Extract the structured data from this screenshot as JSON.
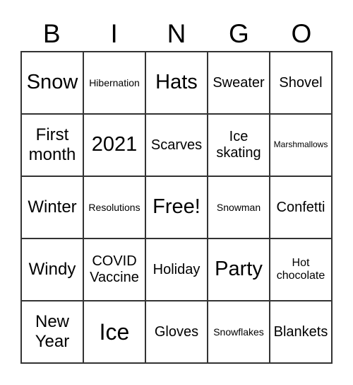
{
  "header": [
    "B",
    "I",
    "N",
    "G",
    "O"
  ],
  "cells": [
    [
      "Snow",
      "Hibernation",
      "Hats",
      "Sweater",
      "Shovel"
    ],
    [
      "First month",
      "2021",
      "Scarves",
      "Ice skating",
      "Marshmallows"
    ],
    [
      "Winter",
      "Resolutions",
      "Free!",
      "Snowman",
      "Confetti"
    ],
    [
      "Windy",
      "COVID Vaccine",
      "Holiday",
      "Party",
      "Hot chocolate"
    ],
    [
      "New Year",
      "Ice",
      "Gloves",
      "Snowflakes",
      "Blankets"
    ]
  ]
}
